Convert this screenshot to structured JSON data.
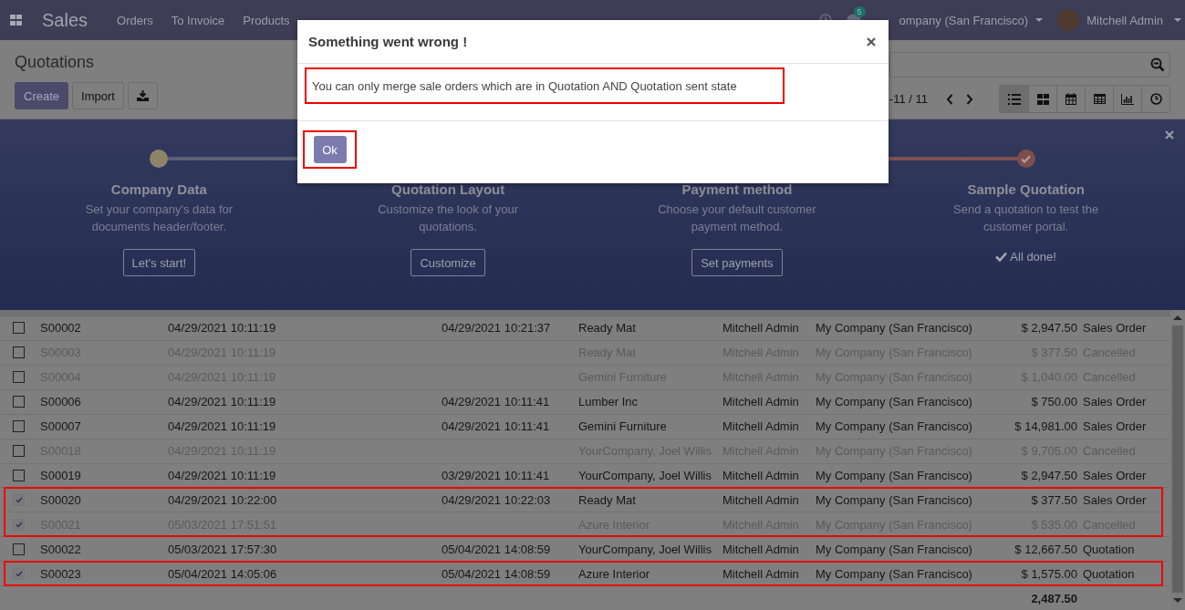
{
  "navbar": {
    "app": "Sales",
    "menu": [
      "Orders",
      "To Invoice",
      "Products"
    ],
    "notifications": "5",
    "company": "ompany (San Francisco)",
    "user": "Mitchell Admin"
  },
  "control_panel": {
    "title": "Quotations",
    "create": "Create",
    "import": "Import",
    "pager": "-11 / 11",
    "views": [
      {
        "kind": "list",
        "selected": true
      },
      {
        "kind": "kanban",
        "selected": false
      },
      {
        "kind": "calendar",
        "selected": false
      },
      {
        "kind": "pivot",
        "selected": false
      },
      {
        "kind": "graph",
        "selected": false
      },
      {
        "kind": "activity",
        "selected": false
      }
    ]
  },
  "onboarding": {
    "steps": [
      {
        "title": "Company Data",
        "description": "Set your company's data for documents header/footer.",
        "button": "Let's start!",
        "done": false
      },
      {
        "title": "Quotation Layout",
        "description": "Customize the look of your quotations.",
        "button": "Customize",
        "done": false
      },
      {
        "title": "Payment method",
        "description": "Choose your default customer payment method.",
        "button": "Set payments",
        "done": false
      },
      {
        "title": "Sample Quotation",
        "description": "Send a quotation to test the customer portal.",
        "done_label": "All done!",
        "done": true
      }
    ]
  },
  "table": {
    "rows": [
      {
        "cells": [
          "S00002",
          "04/29/2021 10:11:19",
          "04/29/2021 10:21:37",
          "Ready Mat",
          "Mitchell Admin",
          "My Company (San Francisco)",
          "$ 2,947.50",
          "Sales Order"
        ],
        "selected": false,
        "muted": false,
        "highlighted": false
      },
      {
        "cells": [
          "S00003",
          "04/29/2021 10:11:19",
          "",
          "Ready Mat",
          "Mitchell Admin",
          "My Company (San Francisco)",
          "$ 377.50",
          "Cancelled"
        ],
        "selected": false,
        "muted": true,
        "highlighted": false
      },
      {
        "cells": [
          "S00004",
          "04/29/2021 10:11:19",
          "",
          "Gemini Furniture",
          "Mitchell Admin",
          "My Company (San Francisco)",
          "$ 1,040.00",
          "Cancelled"
        ],
        "selected": false,
        "muted": true,
        "highlighted": false
      },
      {
        "cells": [
          "S00006",
          "04/29/2021 10:11:19",
          "04/29/2021 10:11:41",
          "Lumber Inc",
          "Mitchell Admin",
          "My Company (San Francisco)",
          "$ 750.00",
          "Sales Order"
        ],
        "selected": false,
        "muted": false,
        "highlighted": false
      },
      {
        "cells": [
          "S00007",
          "04/29/2021 10:11:19",
          "04/29/2021 10:11:41",
          "Gemini Furniture",
          "Mitchell Admin",
          "My Company (San Francisco)",
          "$ 14,981.00",
          "Sales Order"
        ],
        "selected": false,
        "muted": false,
        "highlighted": false
      },
      {
        "cells": [
          "S00018",
          "04/29/2021 10:11:19",
          "",
          "YourCompany, Joel Willis",
          "Mitchell Admin",
          "My Company (San Francisco)",
          "$ 9,705.00",
          "Cancelled"
        ],
        "selected": false,
        "muted": true,
        "highlighted": false
      },
      {
        "cells": [
          "S00019",
          "04/29/2021 10:11:19",
          "03/29/2021 10:11:41",
          "YourCompany, Joel Willis",
          "Mitchell Admin",
          "My Company (San Francisco)",
          "$ 2,947.50",
          "Sales Order"
        ],
        "selected": false,
        "muted": false,
        "highlighted": false
      },
      {
        "cells": [
          "S00020",
          "04/29/2021 10:22:00",
          "04/29/2021 10:22:03",
          "Ready Mat",
          "Mitchell Admin",
          "My Company (San Francisco)",
          "$ 377.50",
          "Sales Order"
        ],
        "selected": true,
        "muted": false,
        "highlighted": true
      },
      {
        "cells": [
          "S00021",
          "05/03/2021 17:51:51",
          "",
          "Azure Interior",
          "Mitchell Admin",
          "My Company (San Francisco)",
          "$ 535.00",
          "Cancelled"
        ],
        "selected": true,
        "muted": true,
        "highlighted": true
      },
      {
        "cells": [
          "S00022",
          "05/03/2021 17:57:30",
          "05/04/2021 14:08:59",
          "YourCompany, Joel Willis",
          "Mitchell Admin",
          "My Company (San Francisco)",
          "$ 12,667.50",
          "Quotation"
        ],
        "selected": false,
        "muted": false,
        "highlighted": false
      },
      {
        "cells": [
          "S00023",
          "05/04/2021 14:05:06",
          "05/04/2021 14:08:59",
          "Azure Interior",
          "Mitchell Admin",
          "My Company (San Francisco)",
          "$ 1,575.00",
          "Quotation"
        ],
        "selected": true,
        "muted": false,
        "highlighted": true
      }
    ],
    "total": "2,487.50"
  },
  "dialog": {
    "title": "Something went wrong !",
    "message": "You can only merge sale orders which are in Quotation AND Quotation sent state",
    "message_highlighted": true,
    "button": "Ok",
    "button_highlighted": true
  }
}
